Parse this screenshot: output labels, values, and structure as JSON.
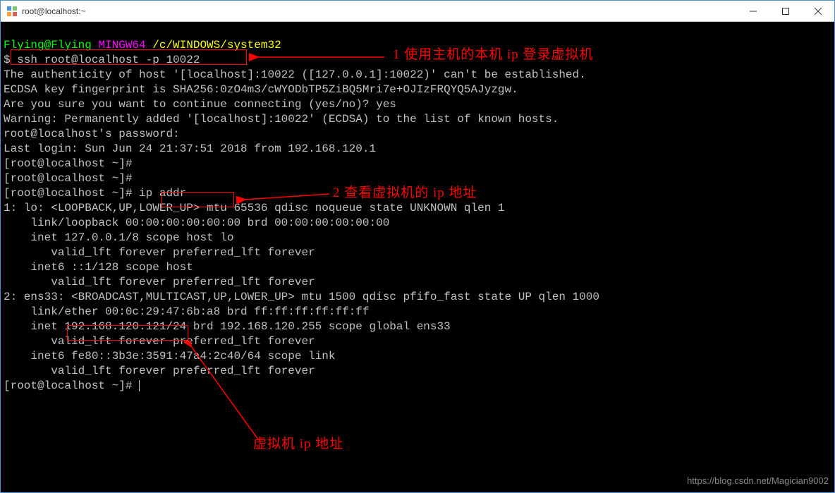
{
  "window": {
    "title": "root@localhost:~"
  },
  "prompt": {
    "user_host": "Flying@Flying ",
    "sys": "MINGW64 ",
    "cwd": "/c/WINDOWS/system32",
    "dollar": "$ ",
    "ssh_cmd": "ssh root@localhost -p 10022"
  },
  "lines": {
    "l3": "The authenticity of host '[localhost]:10022 ([127.0.0.1]:10022)' can't be established.",
    "l4": "ECDSA key fingerprint is SHA256:0zO4m3/cWYODbTP5ZiBQ5Mri7e+OJIzFRQYQ5AJyzgw.",
    "l5": "Are you sure you want to continue connecting (yes/no)? yes",
    "l6": "Warning: Permanently added '[localhost]:10022' (ECDSA) to the list of known hosts.",
    "l7": "root@localhost's password:",
    "l8": "Last login: Sun Jun 24 21:37:51 2018 from 192.168.120.1",
    "l9": "[root@localhost ~]#",
    "l10": "[root@localhost ~]#",
    "l11": "[root@localhost ~]# ip addr",
    "l12": "1: lo: <LOOPBACK,UP,LOWER_UP> mtu 65536 qdisc noqueue state UNKNOWN qlen 1",
    "l13": "    link/loopback 00:00:00:00:00:00 brd 00:00:00:00:00:00",
    "l14": "    inet 127.0.0.1/8 scope host lo",
    "l15": "       valid_lft forever preferred_lft forever",
    "l16": "    inet6 ::1/128 scope host",
    "l17": "       valid_lft forever preferred_lft forever",
    "l18": "2: ens33: <BROADCAST,MULTICAST,UP,LOWER_UP> mtu 1500 qdisc pfifo_fast state UP qlen 1000",
    "l19": "    link/ether 00:0c:29:47:6b:a8 brd ff:ff:ff:ff:ff:ff",
    "l20": "    inet 192.168.120.121/24 brd 192.168.120.255 scope global ens33",
    "l21": "       valid_lft forever preferred_lft forever",
    "l22": "    inet6 fe80::3b3e:3591:47a4:2c40/64 scope link",
    "l23": "       valid_lft forever preferred_lft forever",
    "l24": "[root@localhost ~]# "
  },
  "annotations": {
    "a1": "1 使用主机的本机 ip 登录虚拟机",
    "a2": "2 查看虚拟机的 ip 地址",
    "a3": "虚拟机 ip 地址"
  },
  "highlight_ip": "192.168.120.121",
  "watermark": "https://blog.csdn.net/Magician9002"
}
